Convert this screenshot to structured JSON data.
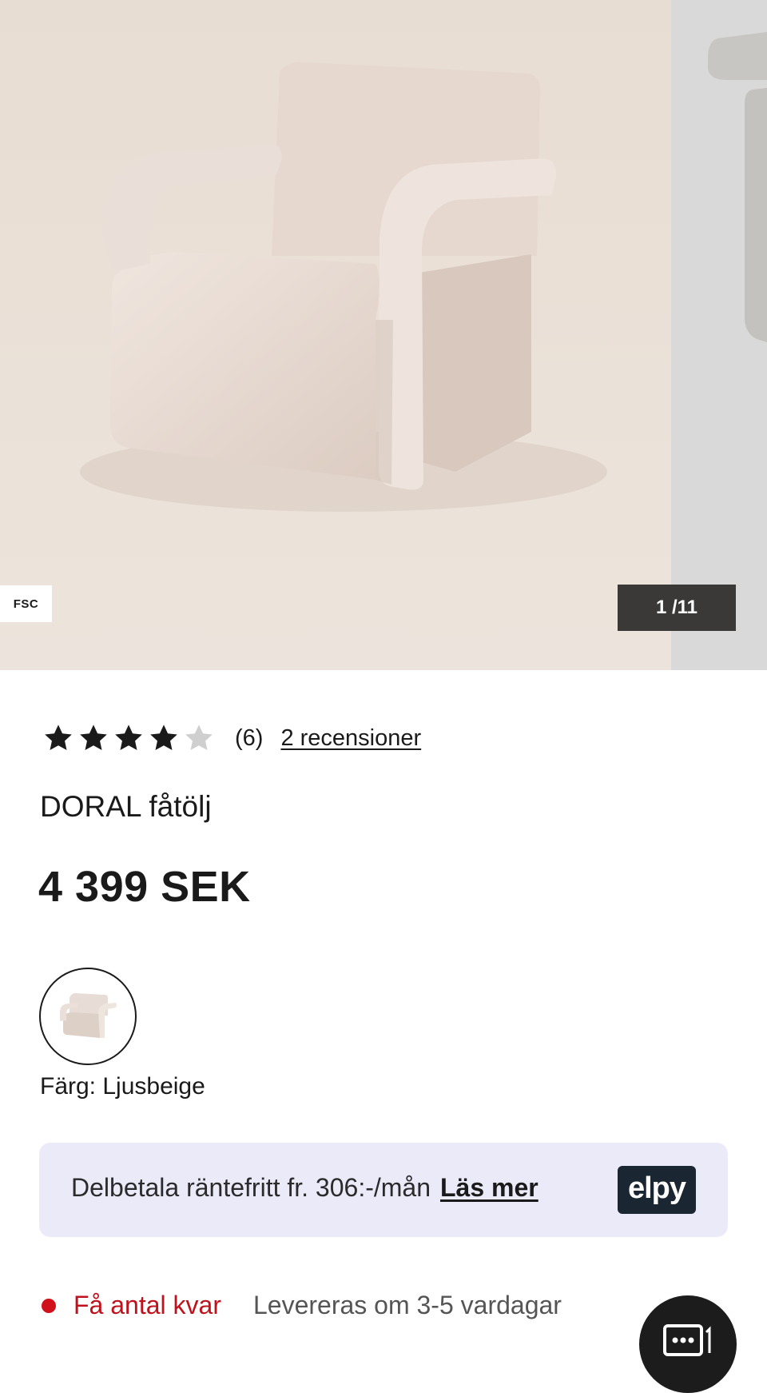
{
  "gallery": {
    "fsc_badge": "FSC",
    "counter": "1 /11",
    "image_name": "doral-armchair-light-beige"
  },
  "rating": {
    "stars_filled": 4,
    "stars_total": 5,
    "count": "(6)",
    "reviews_link": "2 recensioner"
  },
  "product": {
    "title": "DORAL fåtölj",
    "price": "4 399 SEK",
    "color_label": "Färg: Ljusbeige"
  },
  "payment": {
    "text": "Delbetala räntefritt fr. 306:-/mån",
    "link": "Läs mer",
    "logo": "elpy",
    "logo_color": "#1a2733",
    "background": "#ebeaf8"
  },
  "stock": {
    "status": "Få antal kvar",
    "status_color": "#d0101b",
    "delivery": "Levereras om 3-5 vardagar"
  },
  "chat": {
    "icon": "chat-icon"
  }
}
